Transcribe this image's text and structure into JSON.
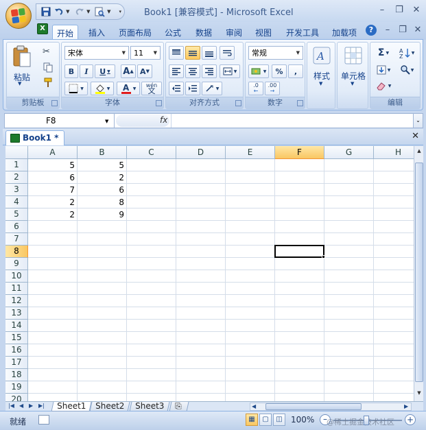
{
  "window": {
    "title": "Book1  [兼容模式] - Microsoft Excel",
    "minimize_glyph": "–",
    "restore_glyph": "❐",
    "close_glyph": "✕"
  },
  "qat": {
    "save_icon": "save-icon",
    "undo_icon": "undo-icon",
    "redo_icon": "redo-icon",
    "preview_icon": "print-preview-icon"
  },
  "ribbon_tabs": [
    "开始",
    "插入",
    "页面布局",
    "公式",
    "数据",
    "审阅",
    "视图",
    "开发工具",
    "加载项"
  ],
  "ribbon_active_tab": "开始",
  "ribbon": {
    "clipboard": {
      "label": "剪贴板",
      "paste": "粘贴"
    },
    "font": {
      "label": "字体",
      "font_name": "宋体",
      "font_size": "11",
      "bold": "B",
      "italic": "I",
      "underline": "U",
      "grow": "A",
      "shrink": "A",
      "phonetic": "wén",
      "phonetic_char": "文"
    },
    "alignment": {
      "label": "对齐方式"
    },
    "number": {
      "label": "数字",
      "format": "常规",
      "percent": "%",
      "comma": ",",
      "inc_decimal": ".0",
      "dec_decimal": ".00"
    },
    "styles": {
      "label": "样式"
    },
    "cells": {
      "label": "单元格"
    },
    "editing": {
      "label": "编辑",
      "sum": "Σ"
    }
  },
  "formula_bar": {
    "name_box": "F8",
    "fx": "fx",
    "formula": ""
  },
  "workbook_tab": {
    "name": "Book1 *",
    "close": "✕"
  },
  "sheet": {
    "columns": [
      "A",
      "B",
      "C",
      "D",
      "E",
      "F",
      "G",
      "H"
    ],
    "rows": [
      "1",
      "2",
      "3",
      "4",
      "5",
      "6",
      "7",
      "8",
      "9",
      "10",
      "11",
      "12",
      "13",
      "14",
      "15",
      "16",
      "17",
      "18",
      "19",
      "20"
    ],
    "selected_cell": "F8",
    "cells": [
      {
        "ref": "A1",
        "value": "5"
      },
      {
        "ref": "B1",
        "value": "5"
      },
      {
        "ref": "A2",
        "value": "6"
      },
      {
        "ref": "B2",
        "value": "2"
      },
      {
        "ref": "A3",
        "value": "7"
      },
      {
        "ref": "B3",
        "value": "6"
      },
      {
        "ref": "A4",
        "value": "2"
      },
      {
        "ref": "B4",
        "value": "8"
      },
      {
        "ref": "A5",
        "value": "2"
      },
      {
        "ref": "B5",
        "value": "9"
      }
    ]
  },
  "sheet_tabs": [
    "Sheet1",
    "Sheet2",
    "Sheet3"
  ],
  "active_sheet": "Sheet1",
  "status": {
    "text": "就绪",
    "zoom": "100%",
    "zoom_minus": "–",
    "zoom_plus": "+"
  },
  "watermark": "@稀土掘金技术社区",
  "colors": {
    "selected_header": "#f9c762",
    "grid_line": "#d4dde9",
    "ribbon_text": "#15428b"
  }
}
